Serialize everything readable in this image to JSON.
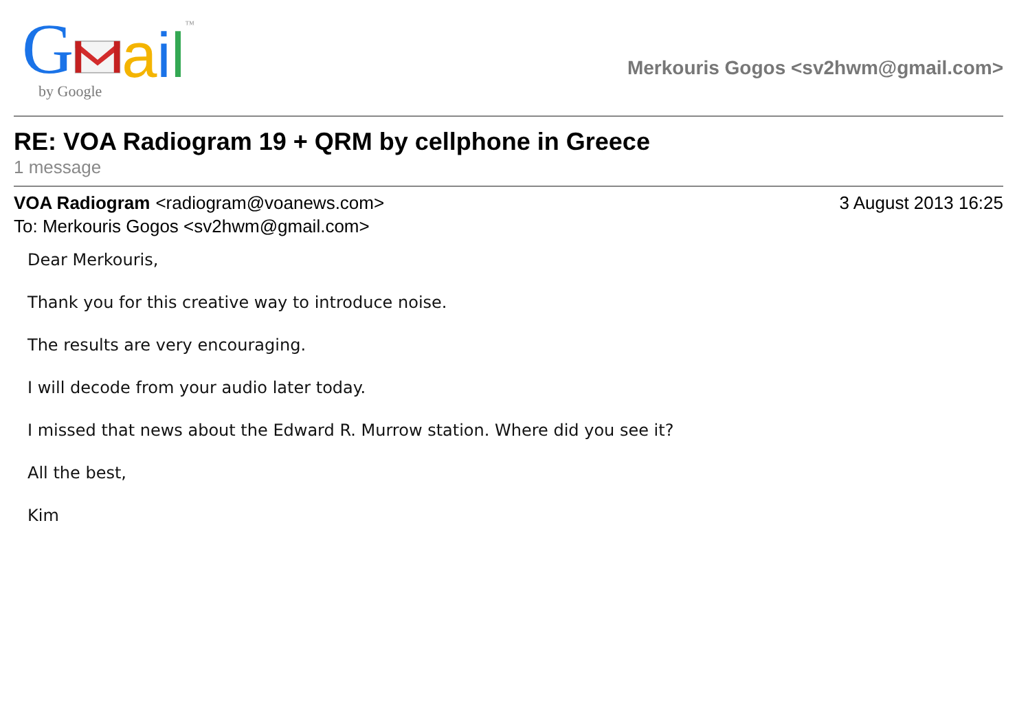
{
  "logo": {
    "left": "G",
    "right": "ail",
    "trademark": "™",
    "byline": "by Google"
  },
  "account": "Merkouris Gogos <sv2hwm@gmail.com>",
  "thread": {
    "subject": "RE: VOA Radiogram 19 + QRM by cellphone in Greece",
    "count": "1 message"
  },
  "message": {
    "sender_name": "VOA Radiogram",
    "sender_address": "<radiogram@voanews.com>",
    "date": "3 August 2013 16:25",
    "to": "To: Merkouris Gogos <sv2hwm@gmail.com>",
    "body": [
      "Dear Merkouris,",
      "Thank you for this creative way to introduce noise.",
      "The results are very encouraging.",
      "I will decode from your audio later today.",
      "I missed that news about the Edward R. Murrow station.  Where did you see it?",
      "All the best,",
      "Kim"
    ]
  }
}
